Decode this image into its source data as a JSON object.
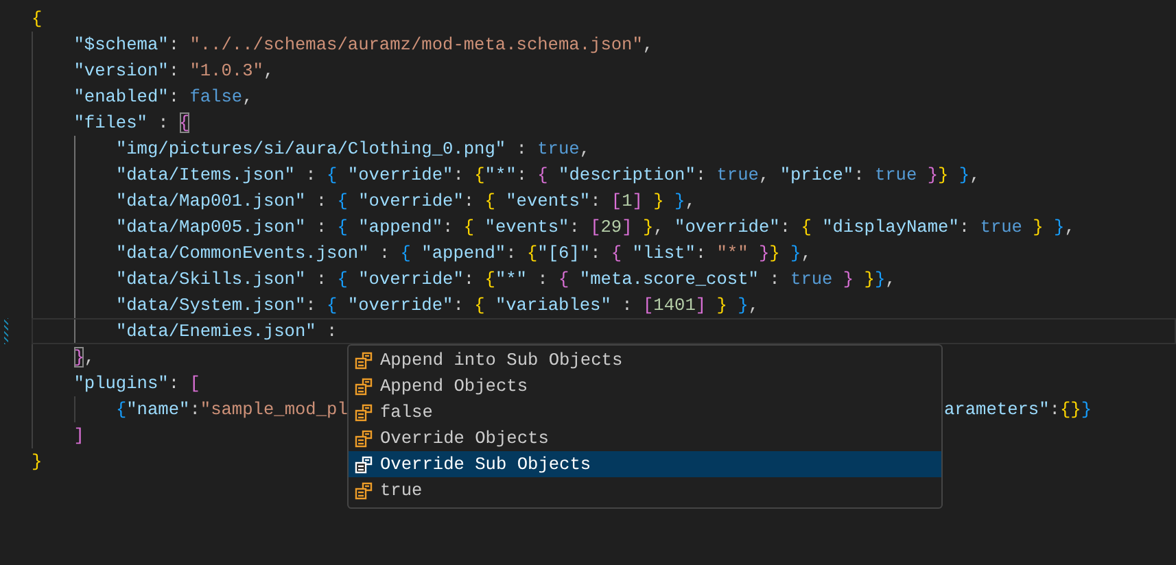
{
  "editor": {
    "lines": [
      {
        "text": "{",
        "current": false,
        "modified": false,
        "matched_bracket": false
      },
      {
        "text": "    \"$schema\": \"../../schemas/auramz/mod-meta.schema.json\",",
        "current": false,
        "modified": false,
        "matched_bracket": false
      },
      {
        "text": "    \"version\": \"1.0.3\",",
        "current": false,
        "modified": false,
        "matched_bracket": false
      },
      {
        "text": "    \"enabled\": false,",
        "current": false,
        "modified": false,
        "matched_bracket": false
      },
      {
        "text": "    \"files\" : {",
        "current": false,
        "modified": false,
        "matched_bracket": true
      },
      {
        "text": "        \"img/pictures/si/aura/Clothing_0.png\" : true,",
        "current": false,
        "modified": false,
        "matched_bracket": false
      },
      {
        "text": "        \"data/Items.json\" : { \"override\": {\"*\": { \"description\": true, \"price\": true }} },",
        "current": false,
        "modified": false,
        "matched_bracket": false
      },
      {
        "text": "        \"data/Map001.json\" : { \"override\": { \"events\": [1] } },",
        "current": false,
        "modified": false,
        "matched_bracket": false
      },
      {
        "text": "        \"data/Map005.json\" : { \"append\": { \"events\": [29] }, \"override\": { \"displayName\": true } },",
        "current": false,
        "modified": false,
        "matched_bracket": false
      },
      {
        "text": "        \"data/CommonEvents.json\" : { \"append\": {\"[6]\": { \"list\": \"*\" }} },",
        "current": false,
        "modified": false,
        "matched_bracket": false
      },
      {
        "text": "        \"data/Skills.json\" : { \"override\": {\"*\" : { \"meta.score_cost\" : true } }},",
        "current": false,
        "modified": false,
        "matched_bracket": false
      },
      {
        "text": "        \"data/System.json\": { \"override\": { \"variables\" : [1401] } },",
        "current": false,
        "modified": false,
        "matched_bracket": false
      },
      {
        "text": "        \"data/Enemies.json\" :",
        "current": true,
        "modified": true,
        "matched_bracket": false
      },
      {
        "text": "    },",
        "current": false,
        "modified": false,
        "matched_bracket": true
      },
      {
        "text": "    \"plugins\": [",
        "current": false,
        "modified": false,
        "matched_bracket": false
      },
      {
        "text": "        {\"name\":\"sample_mod_pl",
        "tail": "arameters\":{}}",
        "current": false,
        "modified": false,
        "matched_bracket": false
      },
      {
        "text": "    ]",
        "current": false,
        "modified": false,
        "matched_bracket": false
      },
      {
        "text": "}",
        "current": false,
        "modified": false,
        "matched_bracket": false
      }
    ]
  },
  "suggestions": [
    {
      "label": "Append into Sub Objects",
      "selected": false
    },
    {
      "label": "Append Objects",
      "selected": false
    },
    {
      "label": "false",
      "selected": false
    },
    {
      "label": "Override Objects",
      "selected": false
    },
    {
      "label": "Override Sub Objects",
      "selected": true
    },
    {
      "label": "true",
      "selected": false
    }
  ]
}
